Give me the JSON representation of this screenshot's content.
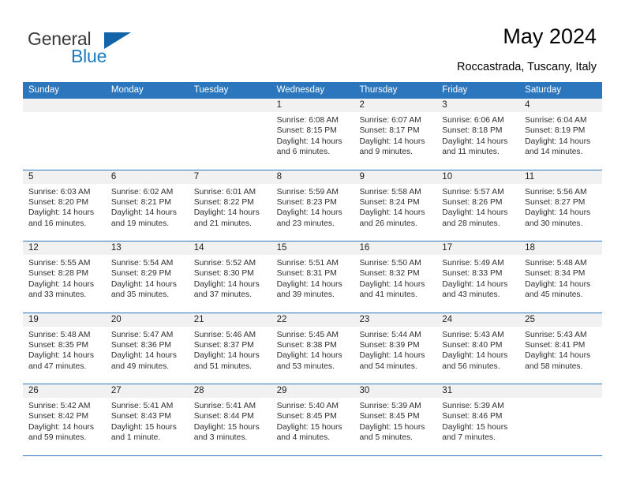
{
  "brand": {
    "name_part1": "General",
    "name_part2": "Blue",
    "triangle_icon": "blue-triangle-icon",
    "colors": {
      "dark": "#3b3b3b",
      "blue": "#1b7bc1",
      "triangle": "#1263a8"
    }
  },
  "header": {
    "title": "May 2024",
    "subtitle": "Roccastrada, Tuscany, Italy"
  },
  "calendar": {
    "accent_color": "#2b76bd",
    "day_band_color": "#f1f1f1",
    "weekdays": [
      "Sunday",
      "Monday",
      "Tuesday",
      "Wednesday",
      "Thursday",
      "Friday",
      "Saturday"
    ],
    "weeks": [
      [
        {
          "day": "",
          "sunrise": "",
          "sunset": "",
          "daylight1": "",
          "daylight2": "",
          "empty": true
        },
        {
          "day": "",
          "sunrise": "",
          "sunset": "",
          "daylight1": "",
          "daylight2": "",
          "empty": true
        },
        {
          "day": "",
          "sunrise": "",
          "sunset": "",
          "daylight1": "",
          "daylight2": "",
          "empty": true
        },
        {
          "day": "1",
          "sunrise": "Sunrise: 6:08 AM",
          "sunset": "Sunset: 8:15 PM",
          "daylight1": "Daylight: 14 hours",
          "daylight2": "and 6 minutes."
        },
        {
          "day": "2",
          "sunrise": "Sunrise: 6:07 AM",
          "sunset": "Sunset: 8:17 PM",
          "daylight1": "Daylight: 14 hours",
          "daylight2": "and 9 minutes."
        },
        {
          "day": "3",
          "sunrise": "Sunrise: 6:06 AM",
          "sunset": "Sunset: 8:18 PM",
          "daylight1": "Daylight: 14 hours",
          "daylight2": "and 11 minutes."
        },
        {
          "day": "4",
          "sunrise": "Sunrise: 6:04 AM",
          "sunset": "Sunset: 8:19 PM",
          "daylight1": "Daylight: 14 hours",
          "daylight2": "and 14 minutes."
        }
      ],
      [
        {
          "day": "5",
          "sunrise": "Sunrise: 6:03 AM",
          "sunset": "Sunset: 8:20 PM",
          "daylight1": "Daylight: 14 hours",
          "daylight2": "and 16 minutes."
        },
        {
          "day": "6",
          "sunrise": "Sunrise: 6:02 AM",
          "sunset": "Sunset: 8:21 PM",
          "daylight1": "Daylight: 14 hours",
          "daylight2": "and 19 minutes."
        },
        {
          "day": "7",
          "sunrise": "Sunrise: 6:01 AM",
          "sunset": "Sunset: 8:22 PM",
          "daylight1": "Daylight: 14 hours",
          "daylight2": "and 21 minutes."
        },
        {
          "day": "8",
          "sunrise": "Sunrise: 5:59 AM",
          "sunset": "Sunset: 8:23 PM",
          "daylight1": "Daylight: 14 hours",
          "daylight2": "and 23 minutes."
        },
        {
          "day": "9",
          "sunrise": "Sunrise: 5:58 AM",
          "sunset": "Sunset: 8:24 PM",
          "daylight1": "Daylight: 14 hours",
          "daylight2": "and 26 minutes."
        },
        {
          "day": "10",
          "sunrise": "Sunrise: 5:57 AM",
          "sunset": "Sunset: 8:26 PM",
          "daylight1": "Daylight: 14 hours",
          "daylight2": "and 28 minutes."
        },
        {
          "day": "11",
          "sunrise": "Sunrise: 5:56 AM",
          "sunset": "Sunset: 8:27 PM",
          "daylight1": "Daylight: 14 hours",
          "daylight2": "and 30 minutes."
        }
      ],
      [
        {
          "day": "12",
          "sunrise": "Sunrise: 5:55 AM",
          "sunset": "Sunset: 8:28 PM",
          "daylight1": "Daylight: 14 hours",
          "daylight2": "and 33 minutes."
        },
        {
          "day": "13",
          "sunrise": "Sunrise: 5:54 AM",
          "sunset": "Sunset: 8:29 PM",
          "daylight1": "Daylight: 14 hours",
          "daylight2": "and 35 minutes."
        },
        {
          "day": "14",
          "sunrise": "Sunrise: 5:52 AM",
          "sunset": "Sunset: 8:30 PM",
          "daylight1": "Daylight: 14 hours",
          "daylight2": "and 37 minutes."
        },
        {
          "day": "15",
          "sunrise": "Sunrise: 5:51 AM",
          "sunset": "Sunset: 8:31 PM",
          "daylight1": "Daylight: 14 hours",
          "daylight2": "and 39 minutes."
        },
        {
          "day": "16",
          "sunrise": "Sunrise: 5:50 AM",
          "sunset": "Sunset: 8:32 PM",
          "daylight1": "Daylight: 14 hours",
          "daylight2": "and 41 minutes."
        },
        {
          "day": "17",
          "sunrise": "Sunrise: 5:49 AM",
          "sunset": "Sunset: 8:33 PM",
          "daylight1": "Daylight: 14 hours",
          "daylight2": "and 43 minutes."
        },
        {
          "day": "18",
          "sunrise": "Sunrise: 5:48 AM",
          "sunset": "Sunset: 8:34 PM",
          "daylight1": "Daylight: 14 hours",
          "daylight2": "and 45 minutes."
        }
      ],
      [
        {
          "day": "19",
          "sunrise": "Sunrise: 5:48 AM",
          "sunset": "Sunset: 8:35 PM",
          "daylight1": "Daylight: 14 hours",
          "daylight2": "and 47 minutes."
        },
        {
          "day": "20",
          "sunrise": "Sunrise: 5:47 AM",
          "sunset": "Sunset: 8:36 PM",
          "daylight1": "Daylight: 14 hours",
          "daylight2": "and 49 minutes."
        },
        {
          "day": "21",
          "sunrise": "Sunrise: 5:46 AM",
          "sunset": "Sunset: 8:37 PM",
          "daylight1": "Daylight: 14 hours",
          "daylight2": "and 51 minutes."
        },
        {
          "day": "22",
          "sunrise": "Sunrise: 5:45 AM",
          "sunset": "Sunset: 8:38 PM",
          "daylight1": "Daylight: 14 hours",
          "daylight2": "and 53 minutes."
        },
        {
          "day": "23",
          "sunrise": "Sunrise: 5:44 AM",
          "sunset": "Sunset: 8:39 PM",
          "daylight1": "Daylight: 14 hours",
          "daylight2": "and 54 minutes."
        },
        {
          "day": "24",
          "sunrise": "Sunrise: 5:43 AM",
          "sunset": "Sunset: 8:40 PM",
          "daylight1": "Daylight: 14 hours",
          "daylight2": "and 56 minutes."
        },
        {
          "day": "25",
          "sunrise": "Sunrise: 5:43 AM",
          "sunset": "Sunset: 8:41 PM",
          "daylight1": "Daylight: 14 hours",
          "daylight2": "and 58 minutes."
        }
      ],
      [
        {
          "day": "26",
          "sunrise": "Sunrise: 5:42 AM",
          "sunset": "Sunset: 8:42 PM",
          "daylight1": "Daylight: 14 hours",
          "daylight2": "and 59 minutes."
        },
        {
          "day": "27",
          "sunrise": "Sunrise: 5:41 AM",
          "sunset": "Sunset: 8:43 PM",
          "daylight1": "Daylight: 15 hours",
          "daylight2": "and 1 minute."
        },
        {
          "day": "28",
          "sunrise": "Sunrise: 5:41 AM",
          "sunset": "Sunset: 8:44 PM",
          "daylight1": "Daylight: 15 hours",
          "daylight2": "and 3 minutes."
        },
        {
          "day": "29",
          "sunrise": "Sunrise: 5:40 AM",
          "sunset": "Sunset: 8:45 PM",
          "daylight1": "Daylight: 15 hours",
          "daylight2": "and 4 minutes."
        },
        {
          "day": "30",
          "sunrise": "Sunrise: 5:39 AM",
          "sunset": "Sunset: 8:45 PM",
          "daylight1": "Daylight: 15 hours",
          "daylight2": "and 5 minutes."
        },
        {
          "day": "31",
          "sunrise": "Sunrise: 5:39 AM",
          "sunset": "Sunset: 8:46 PM",
          "daylight1": "Daylight: 15 hours",
          "daylight2": "and 7 minutes."
        },
        {
          "day": "",
          "sunrise": "",
          "sunset": "",
          "daylight1": "",
          "daylight2": "",
          "empty": true
        }
      ]
    ]
  }
}
